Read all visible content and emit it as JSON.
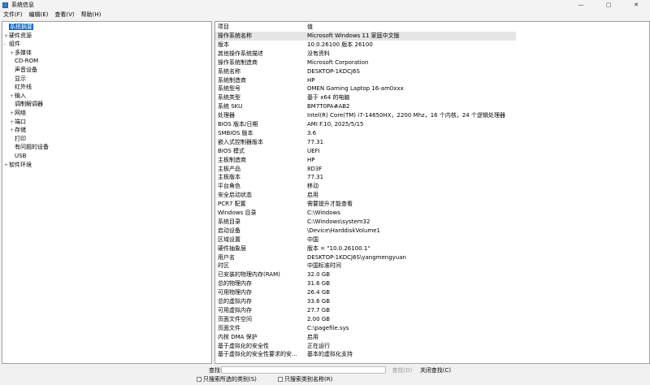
{
  "window": {
    "title": "系统信息",
    "min_glyph": "—",
    "max_glyph": "▢",
    "close_glyph": "✕"
  },
  "menu": [
    "文件(F)",
    "编辑(E)",
    "查看(V)",
    "帮助(H)"
  ],
  "tree": [
    {
      "label": "系统摘要",
      "level": 0,
      "expander": "",
      "selected": true
    },
    {
      "label": "硬件资源",
      "level": 0,
      "expander": "+"
    },
    {
      "label": "组件",
      "level": 0,
      "expander": "-"
    },
    {
      "label": "多媒体",
      "level": 1,
      "expander": "+"
    },
    {
      "label": "CD-ROM",
      "level": 1,
      "expander": ""
    },
    {
      "label": "声音设备",
      "level": 1,
      "expander": ""
    },
    {
      "label": "显示",
      "level": 1,
      "expander": ""
    },
    {
      "label": "红外线",
      "level": 1,
      "expander": ""
    },
    {
      "label": "输入",
      "level": 1,
      "expander": "+"
    },
    {
      "label": "调制解调器",
      "level": 1,
      "expander": ""
    },
    {
      "label": "网络",
      "level": 1,
      "expander": "+"
    },
    {
      "label": "端口",
      "level": 1,
      "expander": "+"
    },
    {
      "label": "存储",
      "level": 1,
      "expander": "+"
    },
    {
      "label": "打印",
      "level": 1,
      "expander": ""
    },
    {
      "label": "有问题的设备",
      "level": 1,
      "expander": ""
    },
    {
      "label": "USB",
      "level": 1,
      "expander": ""
    },
    {
      "label": "软件环境",
      "level": 0,
      "expander": "+"
    }
  ],
  "table": {
    "headers": [
      "项目",
      "值"
    ],
    "rows": [
      [
        "操作系统名称",
        "Microsoft Windows 11 家庭中文版"
      ],
      [
        "版本",
        "10.0.26100 版本 26100"
      ],
      [
        "其他操作系统描述",
        "没有资料"
      ],
      [
        "操作系统制造商",
        "Microsoft Corporation"
      ],
      [
        "系统名称",
        "DESKTOP-1KDCJ6S"
      ],
      [
        "系统制造商",
        "HP"
      ],
      [
        "系统型号",
        "OMEN Gaming Laptop 16-am0xxx"
      ],
      [
        "系统类型",
        "基于 x64 的电脑"
      ],
      [
        "系统 SKU",
        "BM7T0PA#AB2"
      ],
      [
        "处理器",
        "Intel(R) Core(TM) i7-14650HX，2200 Mhz，16 个内核，24 个逻辑处理器"
      ],
      [
        "BIOS 版本/日期",
        "AMI F.10, 2025/5/15"
      ],
      [
        "SMBIOS 版本",
        "3.6"
      ],
      [
        "嵌入式控制器版本",
        "77.31"
      ],
      [
        "BIOS 模式",
        "UEFI"
      ],
      [
        "主板制造商",
        "HP"
      ],
      [
        "主板产品",
        "8D3F"
      ],
      [
        "主板版本",
        "77.31"
      ],
      [
        "平台角色",
        "移动"
      ],
      [
        "安全启动状态",
        "启用"
      ],
      [
        "PCR7 配置",
        "需要提升才能查看"
      ],
      [
        "Windows 目录",
        "C:\\Windows"
      ],
      [
        "系统目录",
        "C:\\Windows\\system32"
      ],
      [
        "启动设备",
        "\\Device\\HarddiskVolume1"
      ],
      [
        "区域设置",
        "中国"
      ],
      [
        "硬件抽象层",
        "版本 = \"10.0.26100.1\""
      ],
      [
        "用户名",
        "DESKTOP-1KDCJ6S\\yangmengyuan"
      ],
      [
        "时区",
        "中国标准时间"
      ],
      [
        "已安装的物理内存(RAM)",
        "32.0 GB"
      ],
      [
        "总的物理内存",
        "31.6 GB"
      ],
      [
        "可用物理内存",
        "26.4 GB"
      ],
      [
        "总的虚拟内存",
        "33.6 GB"
      ],
      [
        "可用虚拟内存",
        "27.7 GB"
      ],
      [
        "页面文件空间",
        "2.00 GB"
      ],
      [
        "页面文件",
        "C:\\pagefile.sys"
      ],
      [
        "内核 DMA 保护",
        "启用"
      ],
      [
        "基于虚拟化的安全性",
        "正在运行"
      ],
      [
        "基于虚拟化的安全性要求的安...",
        "基本的虚拟化支持"
      ]
    ]
  },
  "search": {
    "label": "查找什",
    "value": "",
    "find_button": "查找(D)",
    "close_find_button": "关闭查找(C)",
    "check_selected": "只搜索所选的类别(S)",
    "check_names": "只搜索类别名称(R)"
  }
}
